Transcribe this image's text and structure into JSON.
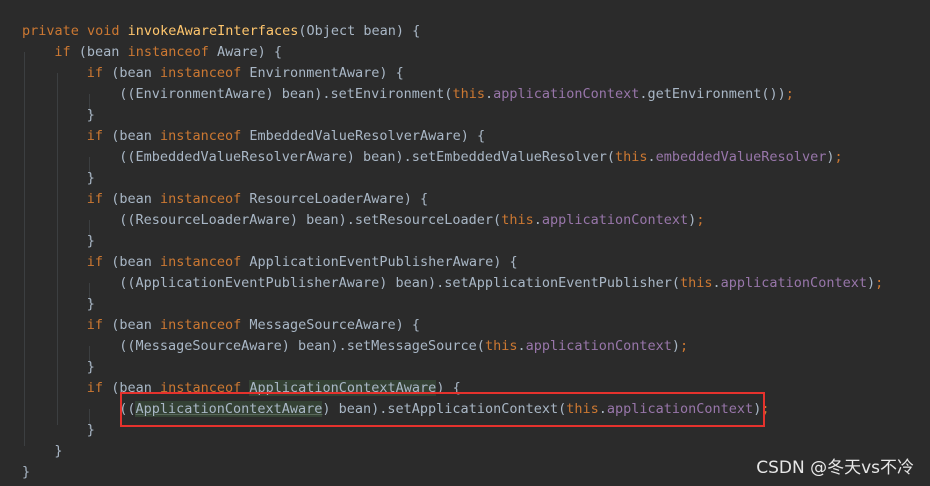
{
  "editor": {
    "lines": [
      {
        "indent": 0,
        "tokens": [
          {
            "t": "private ",
            "c": "kw"
          },
          {
            "t": "void ",
            "c": "kw"
          },
          {
            "t": "invokeAwareInterfaces",
            "c": "fn"
          },
          {
            "t": "(Object bean) {",
            "c": "plain"
          }
        ]
      },
      {
        "indent": 1,
        "tokens": [
          {
            "t": "if ",
            "c": "kw"
          },
          {
            "t": "(bean ",
            "c": "plain"
          },
          {
            "t": "instanceof ",
            "c": "kw"
          },
          {
            "t": "Aware) {",
            "c": "plain"
          }
        ]
      },
      {
        "indent": 2,
        "tokens": [
          {
            "t": "if ",
            "c": "kw"
          },
          {
            "t": "(bean ",
            "c": "plain"
          },
          {
            "t": "instanceof ",
            "c": "kw"
          },
          {
            "t": "EnvironmentAware) {",
            "c": "plain"
          }
        ]
      },
      {
        "indent": 3,
        "tokens": [
          {
            "t": "((EnvironmentAware) bean).setEnvironment(",
            "c": "plain"
          },
          {
            "t": "this",
            "c": "kw"
          },
          {
            "t": ".",
            "c": "plain"
          },
          {
            "t": "applicationContext",
            "c": "field"
          },
          {
            "t": ".getEnvironment())",
            "c": "plain"
          },
          {
            "t": ";",
            "c": "kw"
          }
        ]
      },
      {
        "indent": 2,
        "tokens": [
          {
            "t": "}",
            "c": "plain"
          }
        ]
      },
      {
        "indent": 2,
        "tokens": [
          {
            "t": "if ",
            "c": "kw"
          },
          {
            "t": "(bean ",
            "c": "plain"
          },
          {
            "t": "instanceof ",
            "c": "kw"
          },
          {
            "t": "EmbeddedValueResolverAware) {",
            "c": "plain"
          }
        ]
      },
      {
        "indent": 3,
        "tokens": [
          {
            "t": "((EmbeddedValueResolverAware) bean).setEmbeddedValueResolver(",
            "c": "plain"
          },
          {
            "t": "this",
            "c": "kw"
          },
          {
            "t": ".",
            "c": "plain"
          },
          {
            "t": "embeddedValueResolver",
            "c": "field"
          },
          {
            "t": ")",
            "c": "plain"
          },
          {
            "t": ";",
            "c": "kw"
          }
        ]
      },
      {
        "indent": 2,
        "tokens": [
          {
            "t": "}",
            "c": "plain"
          }
        ]
      },
      {
        "indent": 2,
        "tokens": [
          {
            "t": "if ",
            "c": "kw"
          },
          {
            "t": "(bean ",
            "c": "plain"
          },
          {
            "t": "instanceof ",
            "c": "kw"
          },
          {
            "t": "ResourceLoaderAware) {",
            "c": "plain"
          }
        ]
      },
      {
        "indent": 3,
        "tokens": [
          {
            "t": "((ResourceLoaderAware) bean).setResourceLoader(",
            "c": "plain"
          },
          {
            "t": "this",
            "c": "kw"
          },
          {
            "t": ".",
            "c": "plain"
          },
          {
            "t": "applicationContext",
            "c": "field"
          },
          {
            "t": ")",
            "c": "plain"
          },
          {
            "t": ";",
            "c": "kw"
          }
        ]
      },
      {
        "indent": 2,
        "tokens": [
          {
            "t": "}",
            "c": "plain"
          }
        ]
      },
      {
        "indent": 2,
        "tokens": [
          {
            "t": "if ",
            "c": "kw"
          },
          {
            "t": "(bean ",
            "c": "plain"
          },
          {
            "t": "instanceof ",
            "c": "kw"
          },
          {
            "t": "ApplicationEventPublisherAware) {",
            "c": "plain"
          }
        ]
      },
      {
        "indent": 3,
        "tokens": [
          {
            "t": "((ApplicationEventPublisherAware) bean).setApplicationEventPublisher(",
            "c": "plain"
          },
          {
            "t": "this",
            "c": "kw"
          },
          {
            "t": ".",
            "c": "plain"
          },
          {
            "t": "applicationContext",
            "c": "field"
          },
          {
            "t": ")",
            "c": "plain"
          },
          {
            "t": ";",
            "c": "kw"
          }
        ]
      },
      {
        "indent": 2,
        "tokens": [
          {
            "t": "}",
            "c": "plain"
          }
        ]
      },
      {
        "indent": 2,
        "tokens": [
          {
            "t": "if ",
            "c": "kw"
          },
          {
            "t": "(bean ",
            "c": "plain"
          },
          {
            "t": "instanceof ",
            "c": "kw"
          },
          {
            "t": "MessageSourceAware) {",
            "c": "plain"
          }
        ]
      },
      {
        "indent": 3,
        "tokens": [
          {
            "t": "((MessageSourceAware) bean).setMessageSource(",
            "c": "plain"
          },
          {
            "t": "this",
            "c": "kw"
          },
          {
            "t": ".",
            "c": "plain"
          },
          {
            "t": "applicationContext",
            "c": "field"
          },
          {
            "t": ")",
            "c": "plain"
          },
          {
            "t": ";",
            "c": "kw"
          }
        ]
      },
      {
        "indent": 2,
        "tokens": [
          {
            "t": "}",
            "c": "plain"
          }
        ]
      },
      {
        "indent": 2,
        "tokens": [
          {
            "t": "if ",
            "c": "kw"
          },
          {
            "t": "(bean ",
            "c": "plain"
          },
          {
            "t": "instanceof ",
            "c": "kw"
          },
          {
            "t": "ApplicationContextAware",
            "c": "hl"
          },
          {
            "t": ") {",
            "c": "plain"
          }
        ]
      },
      {
        "indent": 3,
        "tokens": [
          {
            "t": "((",
            "c": "plain"
          },
          {
            "t": "ApplicationContextAware",
            "c": "hl"
          },
          {
            "t": ") bean).setApplicationContext(",
            "c": "plain"
          },
          {
            "t": "this",
            "c": "kw"
          },
          {
            "t": ".",
            "c": "plain"
          },
          {
            "t": "applicationContext",
            "c": "field"
          },
          {
            "t": ")",
            "c": "plain"
          },
          {
            "t": ";",
            "c": "kw"
          }
        ]
      },
      {
        "indent": 2,
        "tokens": [
          {
            "t": "}",
            "c": "plain"
          }
        ]
      },
      {
        "indent": 1,
        "tokens": [
          {
            "t": "}",
            "c": "plain"
          }
        ]
      },
      {
        "indent": 0,
        "tokens": [
          {
            "t": "}",
            "c": "plain"
          }
        ]
      }
    ]
  },
  "colors": {
    "background": "#2b2b2b",
    "keyword": "#cc7832",
    "method": "#ffc66d",
    "field": "#9876aa",
    "text": "#a9b7c6",
    "highlight_box": "#e5322d"
  },
  "watermark": "CSDN @冬天vs不冷"
}
